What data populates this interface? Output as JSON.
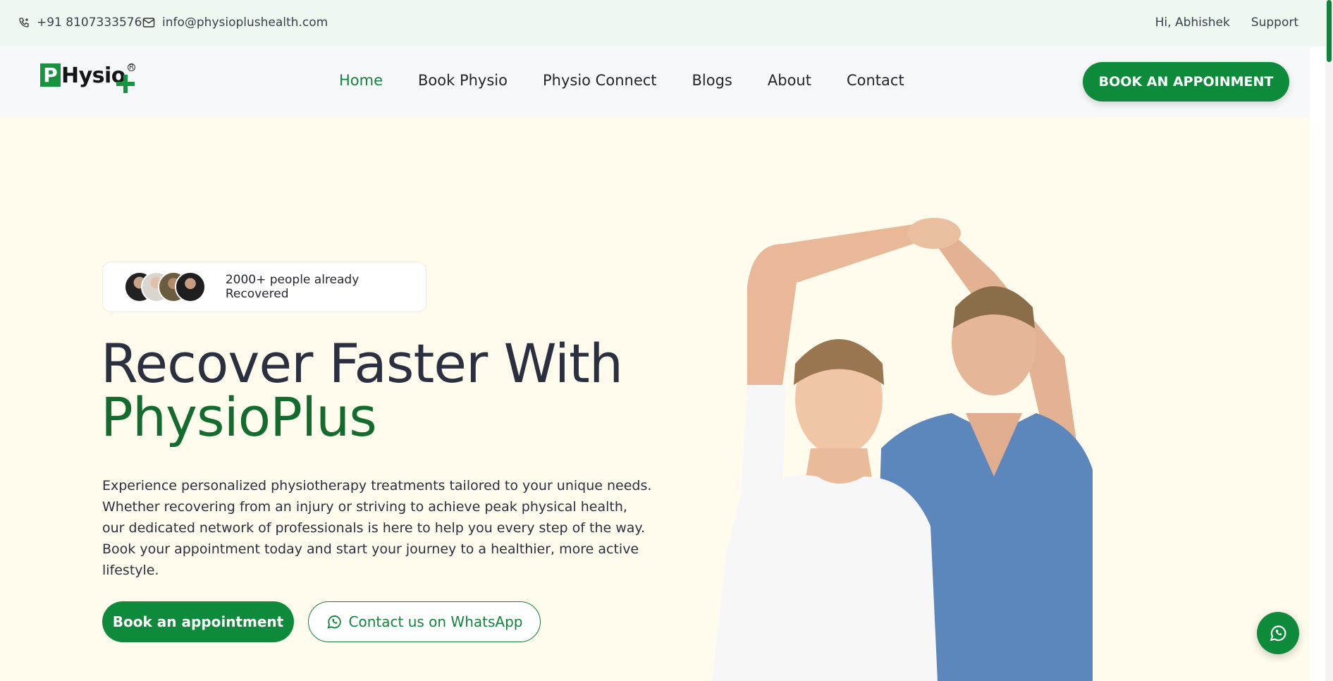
{
  "topbar": {
    "phone": "+91 8107333576",
    "email": "info@physioplushealth.com",
    "greeting": "Hi, Abhishek",
    "support": "Support"
  },
  "logo": {
    "letter": "P",
    "word": "Hysio",
    "brand_color": "#15933f"
  },
  "nav": {
    "items": [
      {
        "label": "Home",
        "active": true
      },
      {
        "label": "Book Physio",
        "active": false
      },
      {
        "label": "Physio Connect",
        "active": false
      },
      {
        "label": "Blogs",
        "active": false
      },
      {
        "label": "About",
        "active": false
      },
      {
        "label": "Contact",
        "active": false
      }
    ],
    "cta": "BOOK AN APPOINMENT"
  },
  "hero": {
    "badge_text": "2000+ people already Recovered",
    "headline_line1": "Recover Faster With",
    "headline_brand": "PhysioPlus",
    "description": "Experience personalized physiotherapy treatments tailored to your unique needs. Whether recovering from an injury or striving to achieve peak physical health, our dedicated network of professionals is here to help you every step of the way. Book your appointment today and start your journey to a healthier, more active lifestyle.",
    "primary_button": "Book an appointment",
    "secondary_button": "Contact us on WhatsApp"
  },
  "colors": {
    "accent": "#0d8a3a",
    "topbar_bg": "#eef8f1",
    "hero_bg": "#fffbed",
    "headline_brand": "#136b2e"
  },
  "icons": [
    "phone-icon",
    "mail-icon",
    "whatsapp-icon"
  ]
}
